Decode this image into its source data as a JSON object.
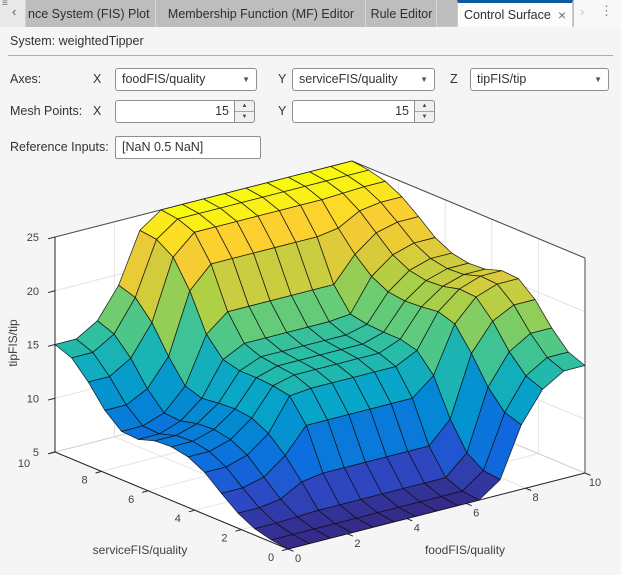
{
  "tab_bar": {
    "tabs": [
      {
        "label": "nce System (FIS) Plot",
        "active": false
      },
      {
        "label": "Membership Function (MF) Editor",
        "active": false
      },
      {
        "label": "Rule Editor",
        "active": false
      },
      {
        "label": "Control Surface",
        "active": true
      }
    ],
    "close_label": "×"
  },
  "icons": {
    "menu": "≡",
    "prev": "‹",
    "next": "›",
    "more": "⋮",
    "dropdown": "▼",
    "spin_up": "▲",
    "spin_down": "▼"
  },
  "system_label": "System: weightedTipper",
  "controls": {
    "axes_label": "Axes:",
    "x_letter": "X",
    "y_letter": "Y",
    "z_letter": "Z",
    "x_axis_value": "foodFIS/quality",
    "y_axis_value": "serviceFIS/quality",
    "z_axis_value": "tipFIS/tip",
    "mesh_points_label": "Mesh Points:",
    "mesh_x_value": "15",
    "mesh_y_value": "15",
    "reference_inputs_label": "Reference Inputs:",
    "reference_inputs_value": "[NaN 0.5 NaN]"
  },
  "colors": {
    "active_tab_accent": "#0d5aa1",
    "surface_colormap": "parula",
    "mesh_edge": "#1a1a1a"
  },
  "chart_data": {
    "type": "surface",
    "xlabel": "foodFIS/quality",
    "ylabel": "serviceFIS/quality",
    "zlabel": "tipFIS/tip",
    "xlim": [
      0,
      10
    ],
    "ylim": [
      0,
      10
    ],
    "zlim": [
      5,
      25
    ],
    "xticks": [
      0,
      2,
      4,
      6,
      8,
      10
    ],
    "yticks": [
      0,
      2,
      4,
      6,
      8,
      10
    ],
    "zticks": [
      5,
      10,
      15,
      20,
      25
    ],
    "mesh_points": 15,
    "view": {
      "azimuth": -37.5,
      "elevation": 30
    },
    "colormap": "parula",
    "x": [
      0,
      0.714,
      1.429,
      2.143,
      2.857,
      3.571,
      4.286,
      5,
      5.714,
      6.429,
      7.143,
      7.857,
      8.571,
      9.286,
      10
    ],
    "y": [
      0,
      0.714,
      1.429,
      2.143,
      2.857,
      3.571,
      4.286,
      5,
      5.714,
      6.429,
      7.143,
      7.857,
      8.571,
      9.286,
      10
    ],
    "z": [
      [
        5.0,
        5.0,
        5.0,
        5.0,
        5.0,
        5.0,
        5.0,
        5.0,
        5.0,
        5.0,
        6.4,
        11.0,
        13.8,
        15.0,
        15.0
      ],
      [
        5.2,
        5.2,
        5.2,
        5.2,
        5.2,
        5.2,
        5.2,
        5.2,
        5.2,
        5.2,
        6.6,
        11.5,
        14.4,
        15.6,
        15.6
      ],
      [
        5.6,
        5.6,
        5.7,
        5.8,
        5.8,
        5.8,
        5.8,
        5.8,
        5.8,
        5.8,
        7.6,
        13.2,
        16.0,
        17.2,
        17.2
      ],
      [
        6.4,
        6.4,
        6.7,
        7.8,
        8.1,
        8.1,
        8.1,
        8.1,
        8.1,
        8.1,
        10.1,
        15.7,
        18.2,
        19.2,
        19.2
      ],
      [
        7.6,
        7.6,
        8.1,
        9.6,
        11.9,
        11.9,
        11.9,
        11.9,
        11.9,
        11.9,
        13.5,
        17.8,
        19.8,
        20.5,
        20.5
      ],
      [
        8.9,
        8.9,
        9.5,
        11.0,
        14.0,
        14.2,
        14.2,
        14.2,
        14.2,
        14.2,
        15.2,
        18.3,
        19.9,
        20.6,
        20.6
      ],
      [
        9.7,
        9.7,
        10.3,
        11.8,
        14.3,
        14.8,
        14.8,
        14.8,
        14.8,
        14.8,
        15.6,
        18.1,
        19.5,
        20.1,
        20.1
      ],
      [
        10.0,
        10.0,
        10.6,
        12.0,
        14.4,
        15.0,
        15.0,
        15.0,
        15.0,
        15.0,
        15.6,
        18.0,
        19.4,
        20.0,
        20.0
      ],
      [
        9.9,
        9.9,
        10.5,
        11.9,
        14.4,
        15.2,
        15.2,
        15.2,
        15.2,
        15.2,
        15.7,
        18.2,
        19.7,
        20.3,
        20.3
      ],
      [
        9.4,
        9.4,
        10.1,
        11.7,
        14.8,
        15.8,
        15.8,
        15.8,
        15.8,
        15.8,
        16.0,
        19.0,
        20.5,
        21.1,
        21.1
      ],
      [
        9.5,
        9.5,
        10.2,
        12.2,
        16.5,
        18.1,
        18.1,
        18.1,
        18.1,
        18.1,
        18.1,
        20.4,
        21.9,
        22.4,
        22.4
      ],
      [
        10.8,
        10.8,
        11.8,
        14.3,
        19.9,
        21.9,
        21.9,
        21.9,
        21.9,
        21.9,
        21.9,
        22.2,
        23.3,
        23.6,
        23.6
      ],
      [
        12.8,
        12.8,
        14.0,
        16.8,
        22.4,
        24.2,
        24.2,
        24.2,
        24.2,
        24.2,
        24.2,
        24.2,
        24.3,
        24.4,
        24.4
      ],
      [
        14.4,
        14.4,
        15.6,
        18.5,
        23.4,
        24.8,
        24.8,
        24.8,
        24.8,
        24.8,
        24.8,
        24.8,
        24.8,
        24.8,
        24.8
      ],
      [
        15.0,
        15.0,
        16.2,
        19.0,
        23.6,
        25.0,
        25.0,
        25.0,
        25.0,
        25.0,
        25.0,
        25.0,
        25.0,
        25.0,
        25.0
      ]
    ]
  }
}
